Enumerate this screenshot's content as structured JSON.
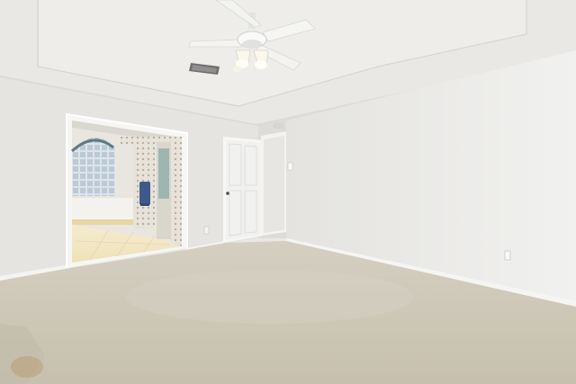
{
  "scene": {
    "kind": "photo",
    "subject": "empty-bedroom",
    "palette": {
      "ceiling": "#ecebe7",
      "ceiling_shadow": "#dcdbd6",
      "wall_left": "#e6e5e2",
      "wall_back": "#e0dfdb",
      "wall_right": "#eeeeec",
      "carpet": "#cfc9b9",
      "carpet_dark": "#bfb8a6",
      "trim": "#f6f6f4",
      "door": "#f3f3f1",
      "bathroom_tile": "#f2e6c2",
      "glass_block": "#b9c8d4",
      "towel": "#3f5a8a"
    },
    "elements": {
      "ceiling_fan": "ceiling-fan-with-light",
      "vent": "ceiling-vent",
      "open_doorway": "doorway-to-bathroom",
      "closed_door": "interior-door",
      "hall_opening": "hall-opening",
      "outlet": "wall-outlet",
      "switch": "light-switch"
    }
  }
}
